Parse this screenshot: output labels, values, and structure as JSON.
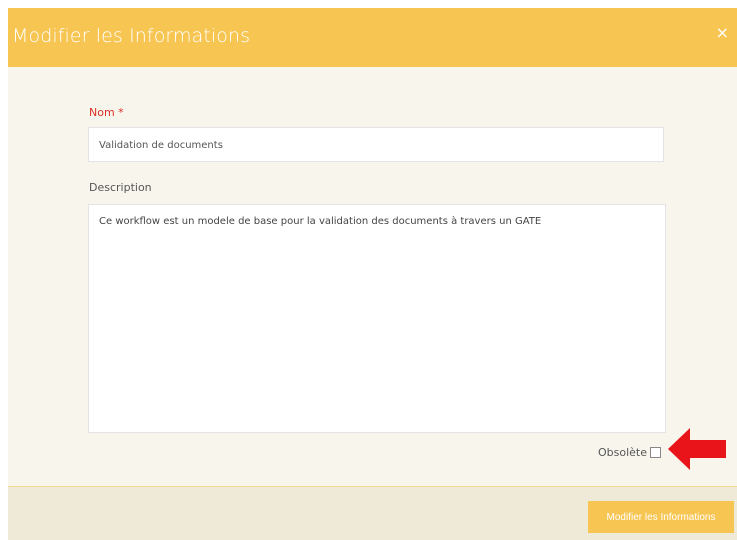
{
  "dialog": {
    "title": "Modifier les Informations",
    "close_glyph": "×"
  },
  "form": {
    "name": {
      "label": "Nom *",
      "value": "Validation de documents"
    },
    "description": {
      "label": "Description",
      "value": "Ce workflow est un modele de base pour la validation des documents à travers un GATE"
    },
    "obsolete": {
      "label": "Obsolète",
      "checked": false
    }
  },
  "footer": {
    "submit_label": "Modifier les Informations"
  },
  "colors": {
    "header_bg": "#f7c552",
    "body_bg": "#f8f6ec",
    "footer_bg": "#eeead7",
    "required_label": "#d9302a",
    "annotation_arrow": "#e8141a"
  },
  "icons": {
    "close": "close-icon",
    "annotation": "red-arrow-icon"
  }
}
